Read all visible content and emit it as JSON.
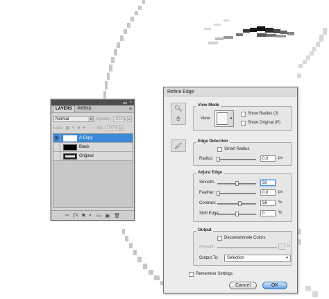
{
  "layers_panel": {
    "tabs": [
      "LAYERS",
      "PATHS"
    ],
    "blend_mode": "Normal",
    "opacity_label": "Opacity:",
    "opacity_value": "100%",
    "lock_label": "Lock:",
    "fill_label": "Fill:",
    "fill_value": "100%",
    "layers": [
      {
        "name": "A Copy",
        "selected": true,
        "visible": true
      },
      {
        "name": "Black",
        "selected": false,
        "visible": false
      },
      {
        "name": "Original",
        "selected": false,
        "visible": false
      }
    ]
  },
  "dialog": {
    "title": "Refine Edge",
    "view_mode": {
      "group_label": "View Mode",
      "view_label": "View:",
      "show_radius": "Show Radius (J)",
      "show_original": "Show Original (P)"
    },
    "edge_detection": {
      "group_label": "Edge Detection",
      "smart_radius": "Smart Radius",
      "radius_label": "Radius:",
      "radius_value": "0,0",
      "radius_unit": "px",
      "radius_level": 0
    },
    "adjust_edge": {
      "group_label": "Adjust Edge",
      "smooth_label": "Smooth:",
      "smooth_value": "50",
      "feather_label": "Feather:",
      "feather_value": "0,0",
      "feather_unit": "px",
      "contrast_label": "Contrast:",
      "contrast_value": "56",
      "contrast_unit": "%",
      "shift_label": "Shift Edge:",
      "shift_value": "0",
      "shift_unit": "%"
    },
    "output": {
      "group_label": "Output",
      "decontaminate": "Decontaminate Colors",
      "amount_label": "Amount:",
      "amount_unit": "%",
      "output_to_label": "Output To:",
      "output_to_value": "Selection"
    },
    "remember_settings": "Remember Settings",
    "cancel": "Cancel",
    "ok": "OK"
  }
}
